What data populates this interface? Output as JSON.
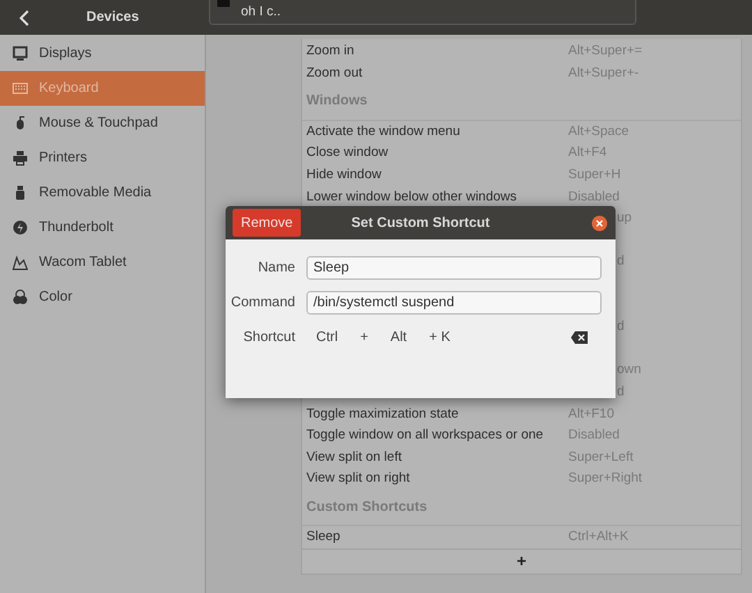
{
  "header": {
    "title": "Devices",
    "popup_text": "oh I c.."
  },
  "sidebar": {
    "items": [
      {
        "label": "Displays",
        "kind": "display",
        "selected": false
      },
      {
        "label": "Keyboard",
        "kind": "keyboard",
        "selected": true
      },
      {
        "label": "Mouse & Touchpad",
        "kind": "mouse",
        "selected": false
      },
      {
        "label": "Printers",
        "kind": "printer",
        "selected": false
      },
      {
        "label": "Removable Media",
        "kind": "usb",
        "selected": false
      },
      {
        "label": "Thunderbolt",
        "kind": "bolt",
        "selected": false
      },
      {
        "label": "Wacom Tablet",
        "kind": "tablet",
        "selected": false
      },
      {
        "label": "Color",
        "kind": "color",
        "selected": false
      }
    ]
  },
  "shortcuts": [
    {
      "kind": "row",
      "name": "Zoom in",
      "shortcut": "Alt+Super+="
    },
    {
      "kind": "row",
      "name": "Zoom out",
      "shortcut": "Alt+Super+-"
    },
    {
      "kind": "header",
      "name": "Windows"
    },
    {
      "kind": "row",
      "name": "Activate the window menu",
      "shortcut": "Alt+Space"
    },
    {
      "kind": "row",
      "name": "Close window",
      "shortcut": "Alt+F4"
    },
    {
      "kind": "row",
      "name": "Hide window",
      "shortcut": "Super+H"
    },
    {
      "kind": "row",
      "name": "Lower window below other windows",
      "shortcut": "Disabled"
    },
    {
      "kind": "covered",
      "fragment": "up"
    },
    {
      "kind": "covered"
    },
    {
      "kind": "covered",
      "fragment": "d"
    },
    {
      "kind": "covered"
    },
    {
      "kind": "covered"
    },
    {
      "kind": "covered",
      "fragment": "d"
    },
    {
      "kind": "covered"
    },
    {
      "kind": "covered",
      "fragment": "own"
    },
    {
      "kind": "covered",
      "fragment": "d"
    },
    {
      "kind": "row",
      "name": "Toggle maximization state",
      "shortcut": "Alt+F10"
    },
    {
      "kind": "row",
      "name": "Toggle window on all workspaces or one",
      "shortcut": "Disabled"
    },
    {
      "kind": "row",
      "name": "View split on left",
      "shortcut": "Super+Left"
    },
    {
      "kind": "row",
      "name": "View split on right",
      "shortcut": "Super+Right"
    },
    {
      "kind": "header",
      "name": "Custom Shortcuts"
    },
    {
      "kind": "row",
      "name": "Sleep",
      "shortcut": "Ctrl+Alt+K"
    },
    {
      "kind": "add",
      "name": "+"
    }
  ],
  "dialog": {
    "title": "Set Custom Shortcut",
    "remove_button": "Remove",
    "fields": [
      {
        "label": "Name",
        "value": "Sleep"
      },
      {
        "label": "Command",
        "value": "/bin/systemctl suspend"
      }
    ],
    "shortcut": {
      "label": "Shortcut",
      "keys": [
        "Ctrl",
        "+",
        "Alt",
        "+ K"
      ]
    }
  }
}
